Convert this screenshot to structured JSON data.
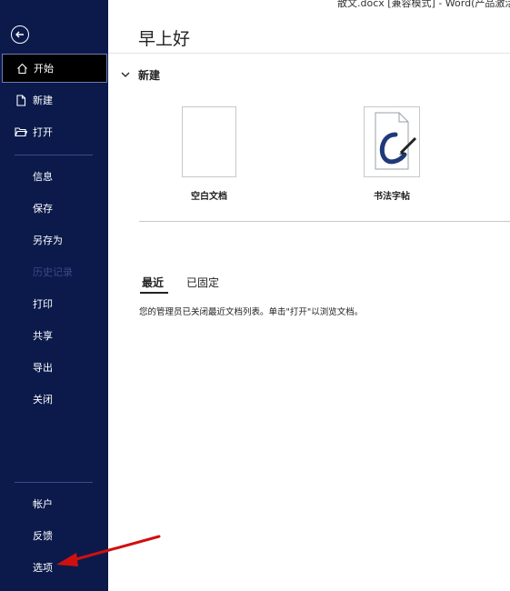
{
  "window": {
    "title": "散文.docx [兼容模式] - Word(产品激活"
  },
  "sidebar": {
    "back_icon": "back-arrow-icon",
    "items": [
      {
        "label": "开始",
        "icon": "home-icon",
        "active": true
      },
      {
        "label": "新建",
        "icon": "new-document-icon"
      },
      {
        "label": "打开",
        "icon": "open-folder-icon"
      },
      {
        "label": "信息"
      },
      {
        "label": "保存"
      },
      {
        "label": "另存为"
      },
      {
        "label": "历史记录",
        "disabled": true
      },
      {
        "label": "打印"
      },
      {
        "label": "共享"
      },
      {
        "label": "导出"
      },
      {
        "label": "关闭"
      },
      {
        "label": "帐户"
      },
      {
        "label": "反馈"
      },
      {
        "label": "选项"
      }
    ]
  },
  "main": {
    "greeting": "早上好",
    "new_section": {
      "label": "新建"
    },
    "templates": [
      {
        "label": "空白文档"
      },
      {
        "label": "书法字帖"
      }
    ],
    "tabs": [
      {
        "label": "最近",
        "active": true
      },
      {
        "label": "已固定"
      }
    ],
    "notice": "您的管理员已关闭最近文档列表。单击\"打开\"以浏览文档。"
  },
  "colors": {
    "sidebar_bg": "#0b1a4b",
    "annotation_arrow": "#d01010"
  }
}
